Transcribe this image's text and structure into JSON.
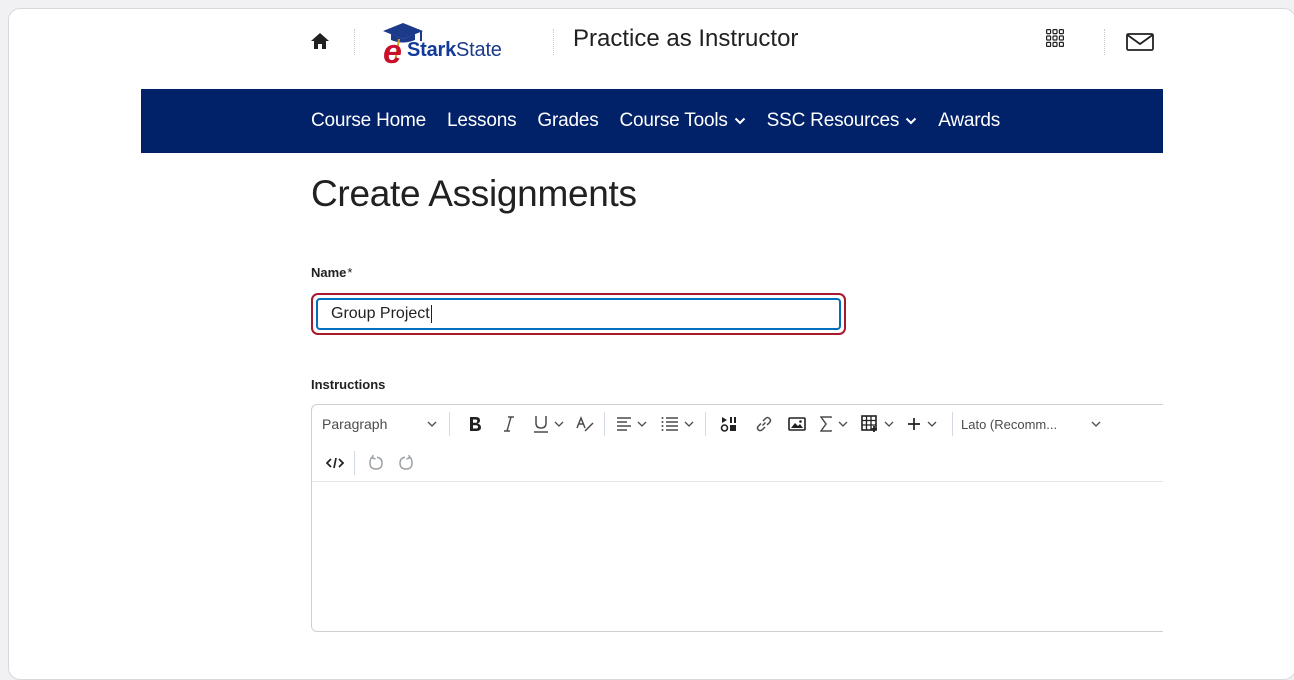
{
  "header": {
    "logo_prefix": "e",
    "logo_bold": "Stark",
    "logo_rest": "State",
    "course_title": "Practice as Instructor",
    "icons": [
      "home-icon",
      "app-grid-icon",
      "mail-icon"
    ]
  },
  "nav": {
    "items": [
      {
        "label": "Course Home",
        "has_dropdown": false
      },
      {
        "label": "Lessons",
        "has_dropdown": false
      },
      {
        "label": "Grades",
        "has_dropdown": false
      },
      {
        "label": "Course Tools",
        "has_dropdown": true
      },
      {
        "label": "SSC Resources",
        "has_dropdown": true
      },
      {
        "label": "Awards",
        "has_dropdown": false
      }
    ]
  },
  "page": {
    "title": "Create Assignments"
  },
  "form": {
    "name_label": "Name",
    "name_required": "*",
    "name_value": "Group Project",
    "instructions_label": "Instructions"
  },
  "editor": {
    "block_format": "Paragraph",
    "font_family": "Lato (Recomm...",
    "icons": [
      "bold-icon",
      "italic-icon",
      "underline-icon",
      "text-color-icon",
      "align-icon",
      "list-icon",
      "insert-stuff-icon",
      "link-icon",
      "image-icon",
      "equation-icon",
      "table-icon",
      "insert-more-icon",
      "source-code-icon",
      "undo-icon",
      "redo-icon"
    ]
  },
  "colors": {
    "nav_bg": "#012169",
    "focus_outer": "#a6192e",
    "focus_inner": "#006fbf"
  }
}
